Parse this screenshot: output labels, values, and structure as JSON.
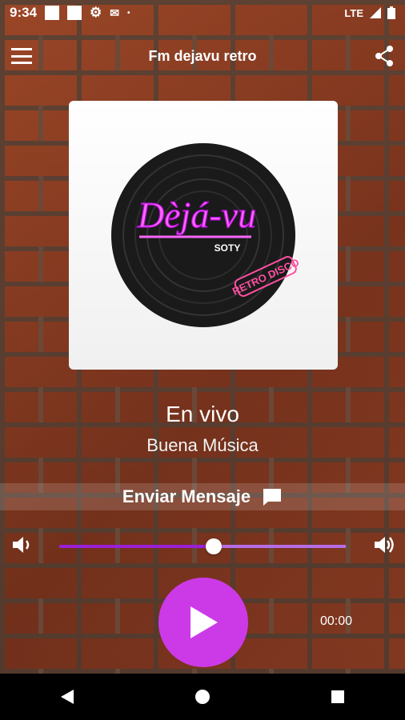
{
  "status_bar": {
    "time": "9:34",
    "network": "LTE"
  },
  "app_bar": {
    "title": "Fm dejavu retro"
  },
  "cover": {
    "logo_text": "Dèjá-vu",
    "logo_subtext": "SOTY",
    "logo_tag": "RETRO DISCO"
  },
  "player": {
    "title": "En vivo",
    "subtitle": "Buena Música",
    "send_message_label": "Enviar Mensaje",
    "elapsed": "00:00",
    "volume_level": 0.54
  },
  "colors": {
    "accent": "#cc3ae8",
    "slider_track": "#b76ce6",
    "slider_fill": "#9b1fd6"
  },
  "icons": [
    "menu-icon",
    "share-icon",
    "chat-icon",
    "volume-low-icon",
    "volume-high-icon",
    "play-icon",
    "back-icon",
    "home-icon",
    "recents-icon"
  ]
}
